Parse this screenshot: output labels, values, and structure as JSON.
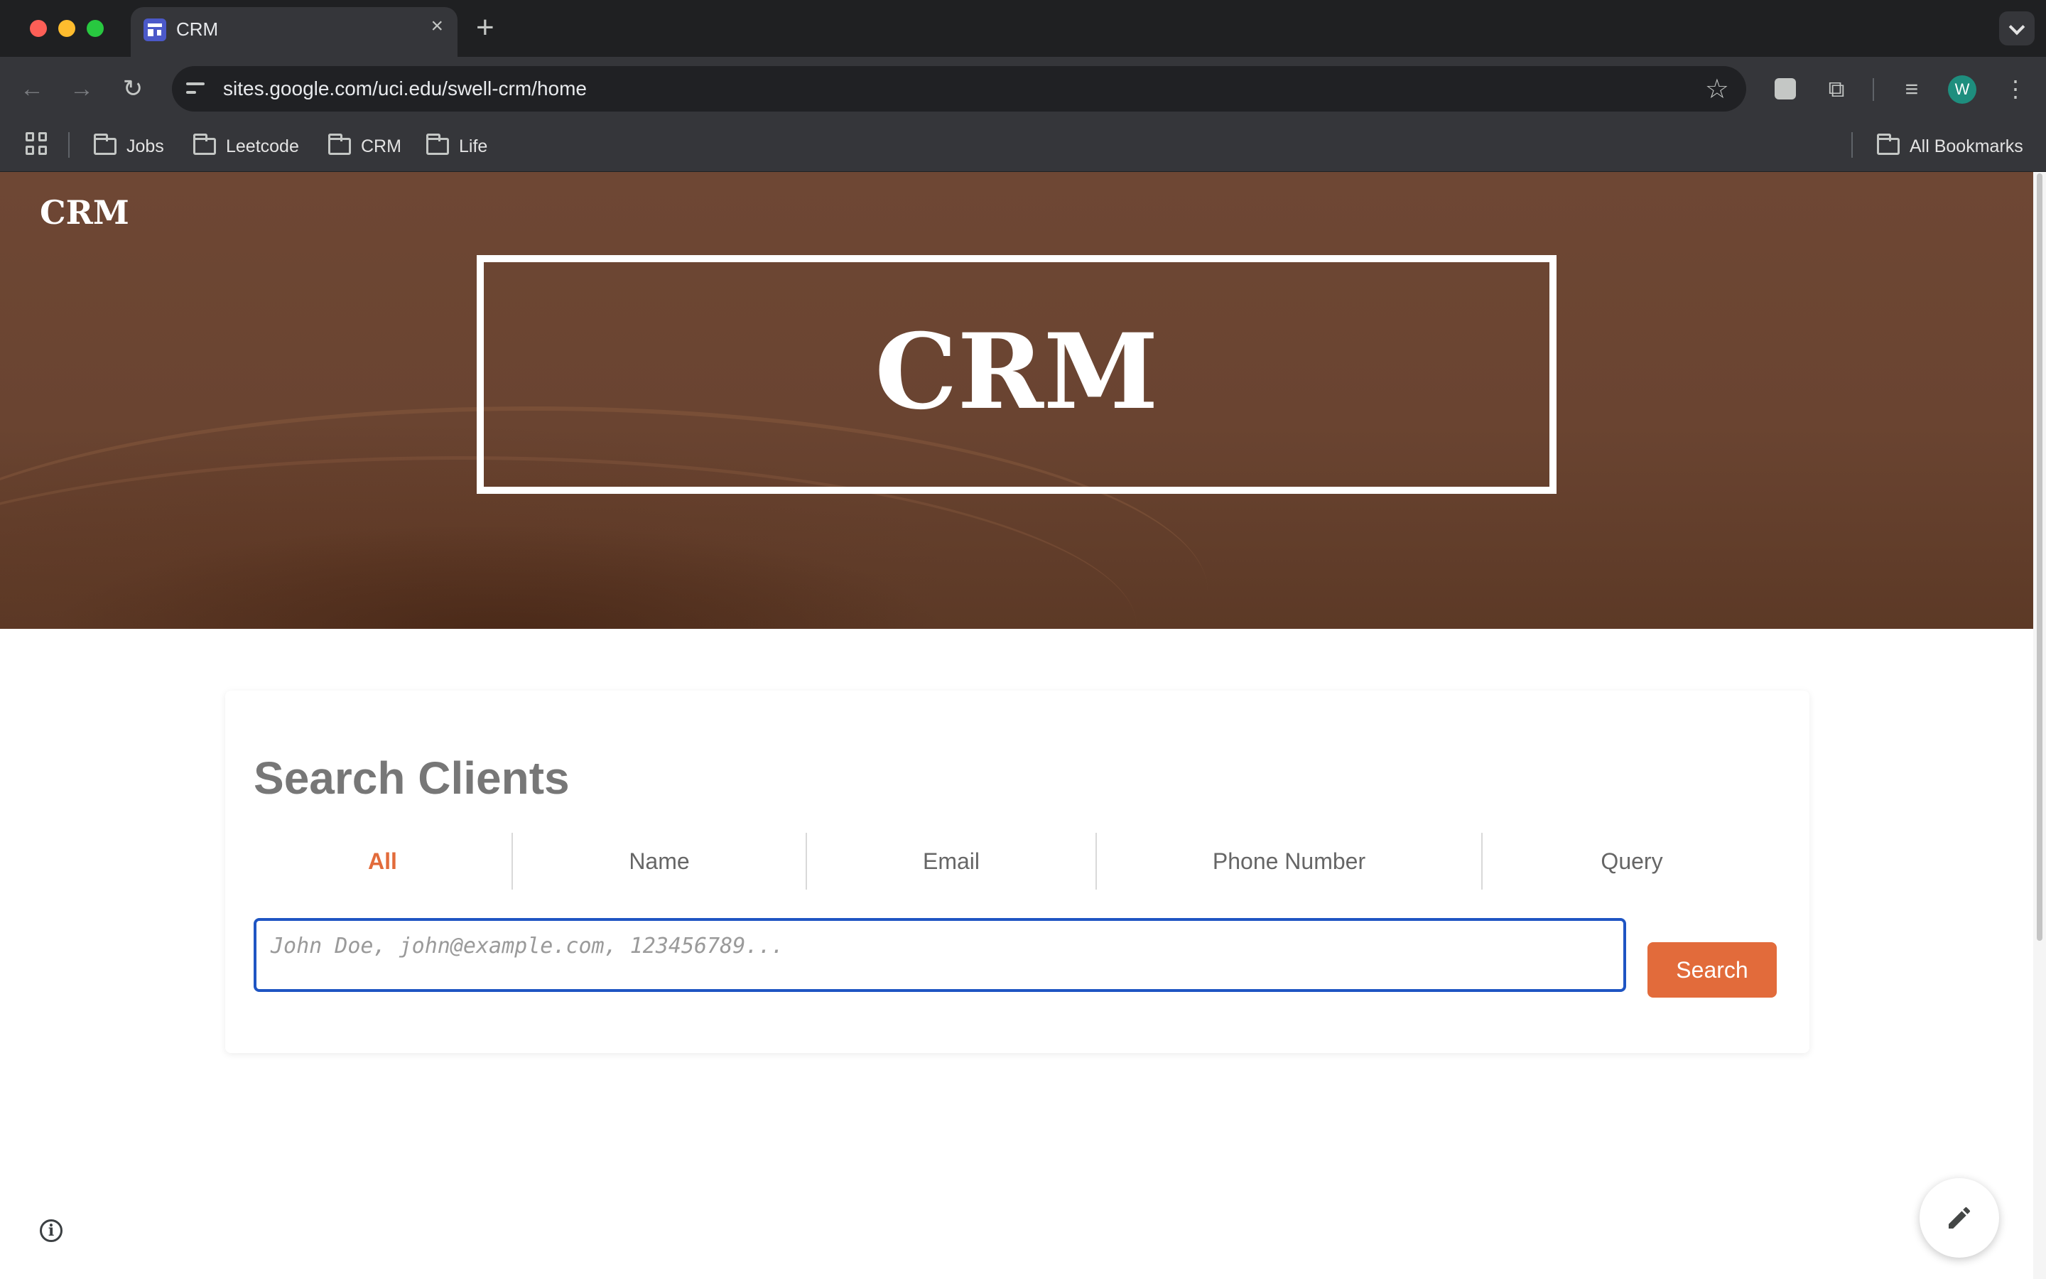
{
  "browser": {
    "tab": {
      "title": "CRM"
    },
    "url": "sites.google.com/uci.edu/swell-crm/home",
    "profile_initial": "W",
    "bookmarks": [
      "Jobs",
      "Leetcode",
      "CRM",
      "Life"
    ],
    "all_bookmarks_label": "All Bookmarks",
    "icons": {
      "tab_close": "×",
      "new_tab": "+",
      "back": "←",
      "forward": "→",
      "reload": "↻",
      "star": "☆",
      "menu": "⋮",
      "extensions": "⧉",
      "media": "≡"
    }
  },
  "site": {
    "brand": "CRM",
    "hero_title": "CRM"
  },
  "search_card": {
    "title": "Search Clients",
    "tabs": [
      {
        "label": "All",
        "active": true
      },
      {
        "label": "Name",
        "active": false
      },
      {
        "label": "Email",
        "active": false
      },
      {
        "label": "Phone Number",
        "active": false
      },
      {
        "label": "Query",
        "active": false
      }
    ],
    "input_placeholder": "John Doe, john@example.com, 123456789...",
    "input_value": "",
    "search_button": "Search"
  },
  "colors": {
    "accent": "#e26b3b",
    "hero_bg": "#6a4431",
    "focus_border": "#1f55c3"
  },
  "page_icons": {
    "info": "i"
  }
}
